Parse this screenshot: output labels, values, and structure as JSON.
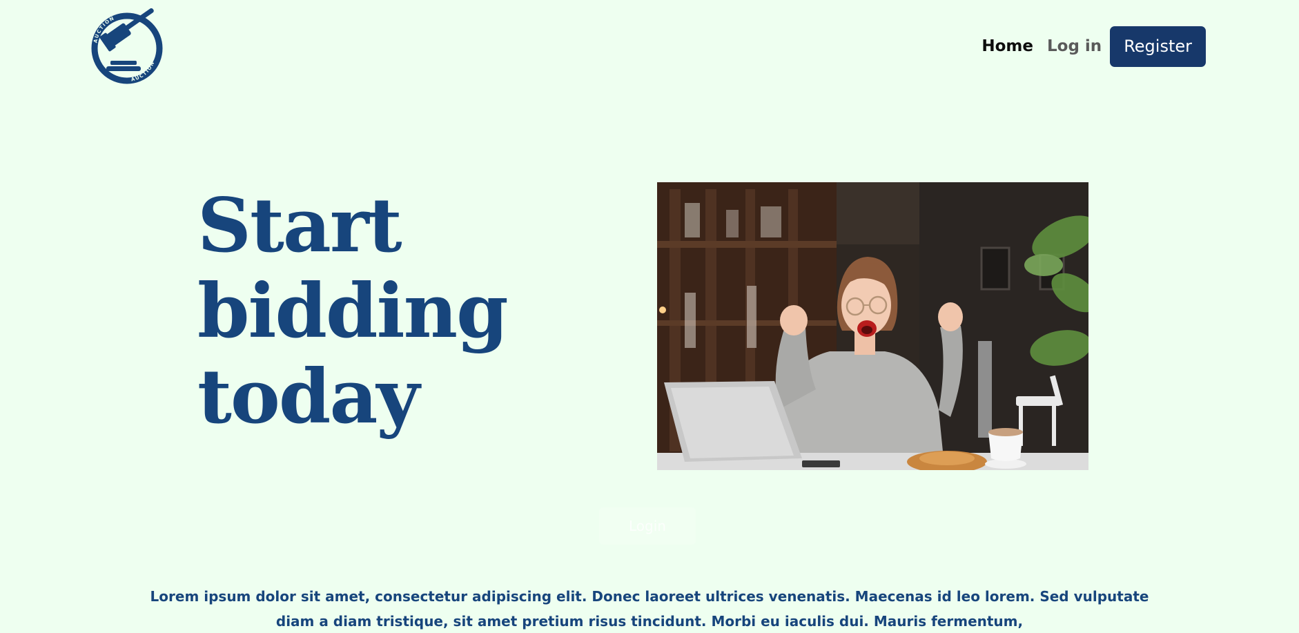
{
  "header": {
    "logo_text": "AUCTION",
    "nav": {
      "home_label": "Home",
      "login_label": "Log in",
      "register_label": "Register"
    }
  },
  "hero": {
    "title_lines": [
      "Start",
      "bidding",
      "today"
    ],
    "photo_alt": "Excited woman celebrating in front of laptop",
    "login_button_label": "Login"
  },
  "intro": {
    "text": "Lorem ipsum dolor sit amet, consectetur adipiscing elit. Donec laoreet ultrices venenatis. Maecenas id leo lorem. Sed vulputate diam a diam tristique, sit amet pretium risus tincidunt. Morbi eu iaculis dui. Mauris fermentum,"
  },
  "colors": {
    "background": "#eefff0",
    "brand_blue": "#17457c",
    "button_navy": "#17386a"
  }
}
